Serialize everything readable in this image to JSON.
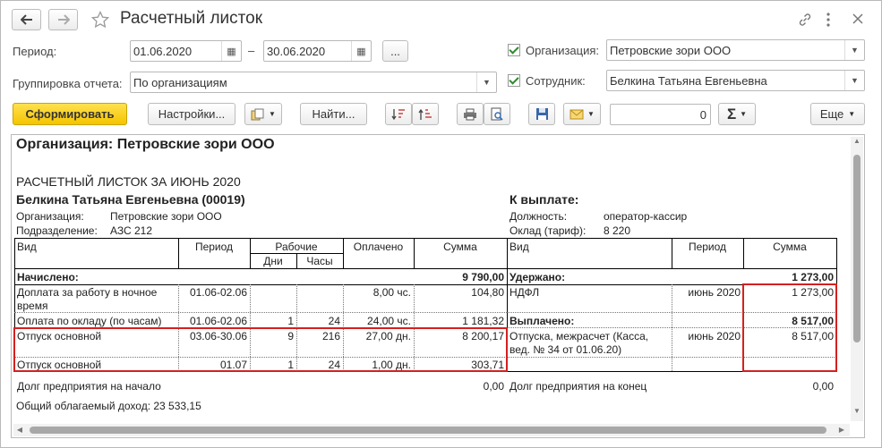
{
  "window": {
    "title": "Расчетный листок"
  },
  "filters": {
    "period_label": "Период:",
    "date_from": "01.06.2020",
    "date_to": "30.06.2020",
    "dash": "–",
    "more_label": "...",
    "group_label": "Группировка отчета:",
    "group_value": "По организациям",
    "org_label": "Организация:",
    "org_value": "Петровские зори ООО",
    "emp_label": "Сотрудник:",
    "emp_value": "Белкина Татьяна Евгеньевна"
  },
  "toolbar": {
    "generate": "Сформировать",
    "settings": "Настройки...",
    "find": "Найти...",
    "sum_value": "0",
    "sigma": "Σ",
    "more": "Еще"
  },
  "report": {
    "org_header": "Организация: Петровские зори ООО",
    "title": "РАСЧЕТНЫЙ ЛИСТОК ЗА ИЮНЬ 2020",
    "employee": "Белкина Татьяна Евгеньевна (00019)",
    "org_lbl": "Организация:",
    "org_val": "Петровские зори ООО",
    "dept_lbl": "Подразделение:",
    "dept_val": "АЗС 212",
    "to_pay": "К выплате:",
    "pos_lbl": "Должность:",
    "pos_val": "оператор-кассир",
    "salary_lbl": "Оклад (тариф):",
    "salary_val": "8 220",
    "h_vid": "Вид",
    "h_period": "Период",
    "h_work": "Рабочие",
    "h_days": "Дни",
    "h_hours": "Часы",
    "h_paid": "Оплачено",
    "h_sum": "Сумма",
    "h_vid2": "Вид",
    "h_period2": "Период",
    "h_sum2": "Сумма",
    "accrued_lbl": "Начислено:",
    "accrued_total": "9 790,00",
    "withheld_lbl": "Удержано:",
    "withheld_total": "1 273,00",
    "accruals": [
      {
        "name": "Доплата за работу в ночное время",
        "period": "01.06-02.06",
        "days": "",
        "hours": "",
        "paid": "8,00 чс.",
        "sum": "104,80"
      },
      {
        "name": "Оплата по окладу (по часам)",
        "period": "01.06-02.06",
        "days": "1",
        "hours": "24",
        "paid": "24,00 чс.",
        "sum": "1 181,32"
      },
      {
        "name": "Отпуск основной",
        "period": "03.06-30.06",
        "days": "9",
        "hours": "216",
        "paid": "27,00 дн.",
        "sum": "8 200,17"
      },
      {
        "name": "Отпуск основной",
        "period": "01.07",
        "days": "1",
        "hours": "24",
        "paid": "1,00 дн.",
        "sum": "303,71"
      }
    ],
    "ndfl_name": "НДФЛ",
    "ndfl_period": "июнь 2020",
    "ndfl_sum": "1 273,00",
    "paid_lbl": "Выплачено:",
    "paid_total": "8 517,00",
    "vac_name": "Отпуска, межрасчет (Касса, вед. № 34 от 01.06.20)",
    "vac_period": "июнь 2020",
    "vac_sum": "8 517,00",
    "debt_start_lbl": "Долг предприятия на начало",
    "debt_start_val": "0,00",
    "debt_end_lbl": "Долг предприятия на конец",
    "debt_end_val": "0,00",
    "taxable": "Общий облагаемый доход: 23 533,15"
  }
}
